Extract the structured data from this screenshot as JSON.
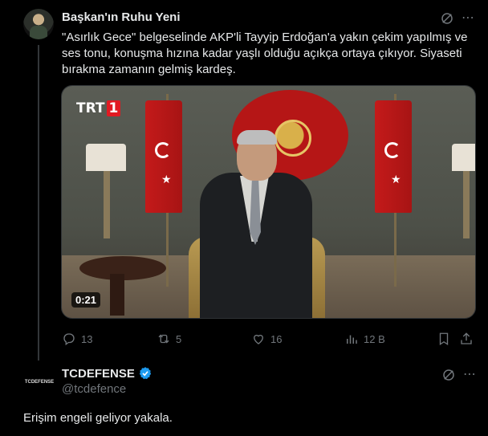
{
  "tweet1": {
    "author_name": "Başkan'ın Ruhu Yeni",
    "text": "\"Asırlık Gece\" belgeselinde AKP'li Tayyip Erdoğan'a yakın çekim yapılmış ve ses tonu, konuşma hızına kadar yaşlı olduğu açıkça ortaya çıkıyor.  Siyaseti bırakma zamanın gelmiş kardeş.",
    "more_icon": "⋯",
    "media": {
      "broadcaster_logo": "TRT",
      "broadcaster_logo_number": "1",
      "duration": "0:21"
    },
    "actions": {
      "replies": "13",
      "reposts": "5",
      "likes": "16",
      "views": "12 B"
    }
  },
  "tweet2": {
    "author_name": "TCDEFENSE",
    "handle": "@tcdefence",
    "avatar_text": "TCDEFENSE",
    "verified": true,
    "more_icon": "⋯",
    "text": "Erişim engeli geliyor yakala."
  },
  "colors": {
    "background": "#000000",
    "text_primary": "#e7e9ea",
    "text_secondary": "#71767b",
    "verified_blue": "#1d9bf0"
  }
}
